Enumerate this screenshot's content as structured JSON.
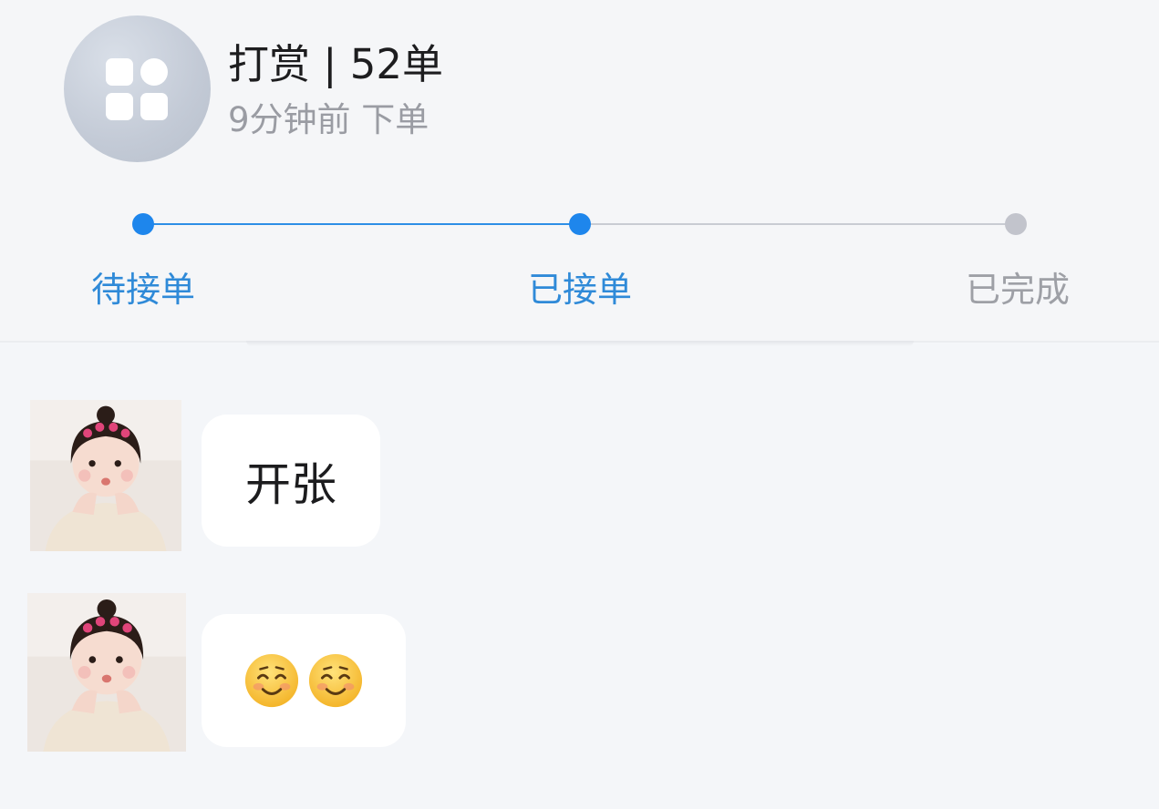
{
  "order": {
    "title": "打赏 | 52单",
    "time": "9分钟前 下单",
    "icon": "app-grid-icon"
  },
  "progress": {
    "steps": [
      {
        "label": "待接单",
        "state": "done"
      },
      {
        "label": "已接单",
        "state": "current"
      },
      {
        "label": "已完成",
        "state": "pending"
      }
    ],
    "colors": {
      "active": "#1e86ec",
      "inactive": "#c2c4cc"
    }
  },
  "chat": {
    "messages": [
      {
        "avatar": "user-avatar",
        "text": "开张"
      },
      {
        "avatar": "user-avatar",
        "emoji": [
          "smiling-face-icon",
          "smiling-face-icon"
        ]
      }
    ]
  }
}
